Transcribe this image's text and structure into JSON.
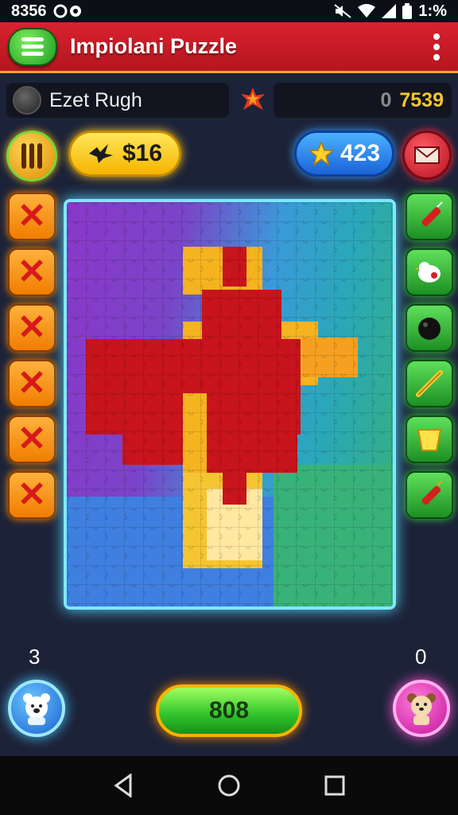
{
  "status_bar": {
    "left_text": "8356",
    "right_text": "1:%"
  },
  "app": {
    "title": "Impiolani Puzzle"
  },
  "player": {
    "name": "Ezet Rugh"
  },
  "score": {
    "prefix": "0",
    "value": "7539"
  },
  "coins": {
    "label": "$16"
  },
  "stars": {
    "label": "423"
  },
  "tools": [
    "dynamite-icon",
    "chicken-icon",
    "bomb-icon",
    "stick-icon",
    "bucket-icon",
    "dynamite-icon"
  ],
  "counters": {
    "left": "3",
    "right": "0"
  },
  "action": {
    "label": "808"
  },
  "colors": {
    "accent_red": "#c8202b",
    "accent_green": "#2ec22a",
    "gold": "#f5c531",
    "board_frame": "#7ee8ff"
  }
}
